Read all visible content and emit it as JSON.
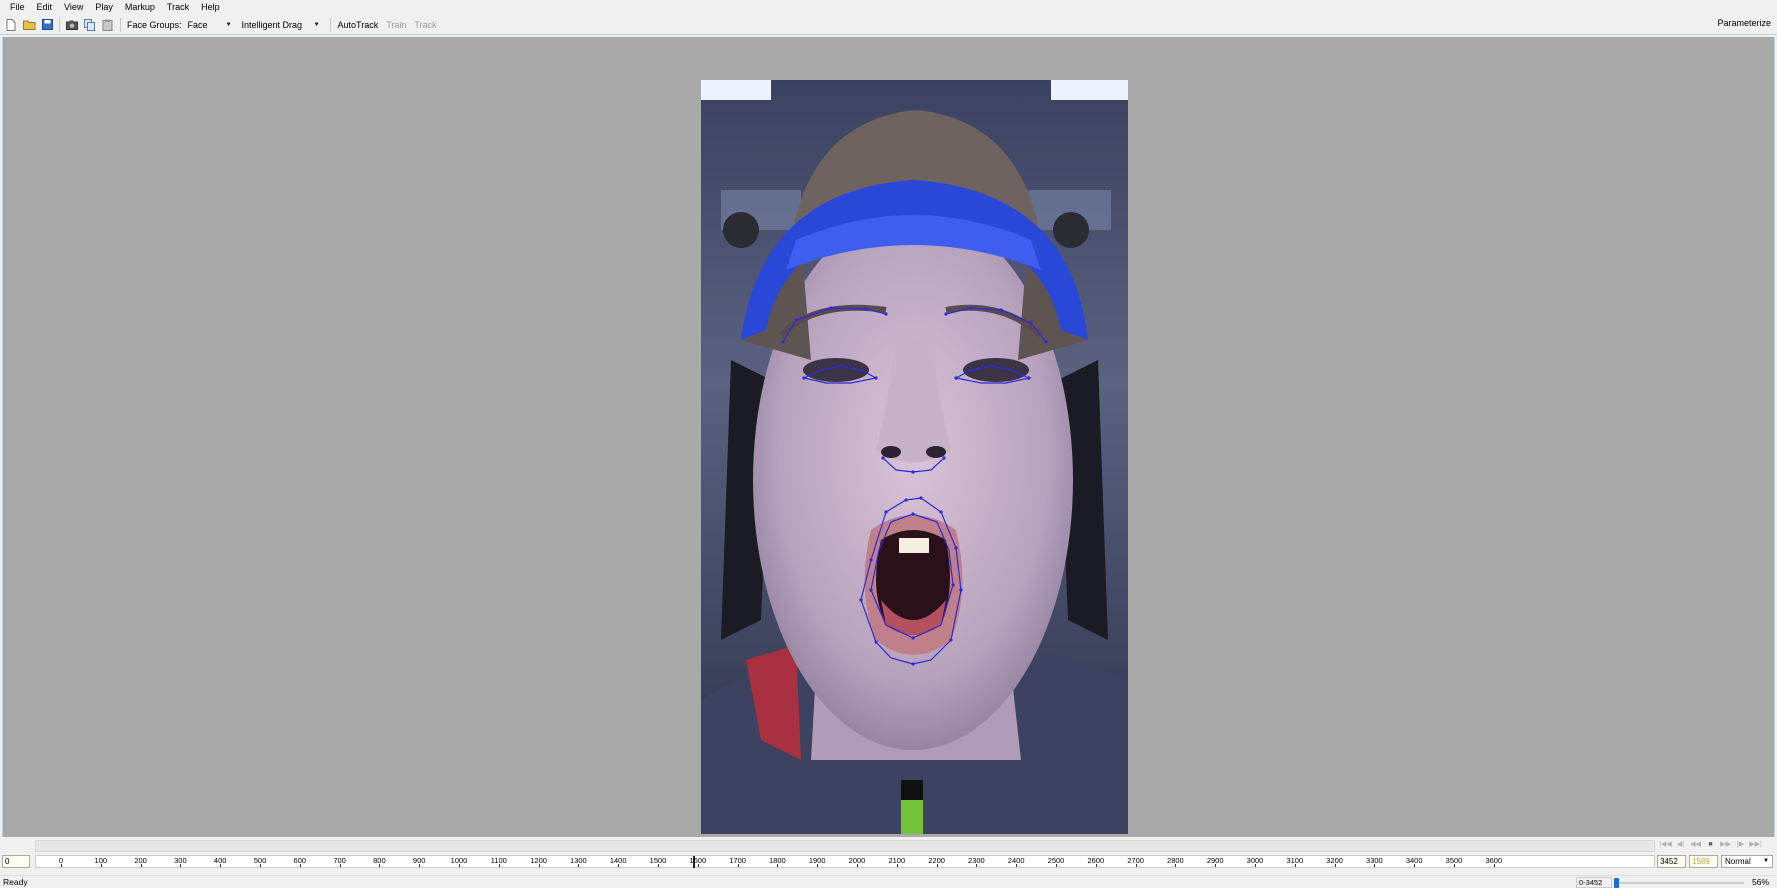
{
  "menu": [
    "File",
    "Edit",
    "View",
    "Play",
    "Markup",
    "Track",
    "Help"
  ],
  "toolbar": {
    "face_groups_label": "Face Groups:",
    "face_groups_value": "Face",
    "drag_mode_value": "Intelligent Drag",
    "autotrack_label": "AutoTrack",
    "train_label": "Train",
    "track_label": "Track",
    "parameterize_label": "Parameterize",
    "icons": [
      "new-file-icon",
      "open-folder-icon",
      "save-icon",
      "camera-icon",
      "copy-icon",
      "paste-icon"
    ]
  },
  "viewport": {
    "background_color": "#a9a9a9",
    "image_description_icon": "video-frame-face"
  },
  "timeline": {
    "start_frame": "0",
    "ticks": [
      "0",
      "100",
      "200",
      "300",
      "400",
      "500",
      "600",
      "700",
      "800",
      "900",
      "1000",
      "1100",
      "1200",
      "1300",
      "1400",
      "1500",
      "1600",
      "1700",
      "1800",
      "1900",
      "2000",
      "2100",
      "2200",
      "2300",
      "2400",
      "2500",
      "2600",
      "2700",
      "2800",
      "2900",
      "3000",
      "3100",
      "3200",
      "3300",
      "3400",
      "3500",
      "3600"
    ],
    "playhead_frame": 1589,
    "end_frame": "3452",
    "current_frame": "1589",
    "playback_speed": "Normal",
    "transport_buttons": [
      "first-frame-icon",
      "prev-key-icon",
      "prev-frame-icon",
      "play-icon",
      "next-frame-icon",
      "next-key-icon",
      "last-frame-icon"
    ]
  },
  "status": {
    "text": "Ready",
    "range": "0-3452",
    "zoom": "56%",
    "zoom_fraction": 0.0
  }
}
